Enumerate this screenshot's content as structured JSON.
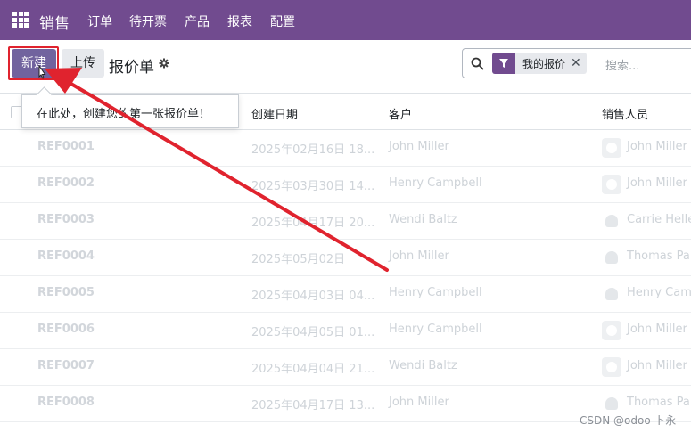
{
  "navbar": {
    "brand": "销售",
    "menu": [
      "订单",
      "待开票",
      "产品",
      "报表",
      "配置"
    ]
  },
  "control": {
    "new_label": "新建",
    "upload_label": "上传",
    "title": "报价单",
    "search": {
      "facet_label": "我的报价",
      "placeholder": "搜索..."
    }
  },
  "tooltip": "在此处，创建您的第一张报价单！",
  "table": {
    "columns": [
      "创建日期",
      "客户",
      "销售人员"
    ],
    "rows": [
      {
        "ref": "REF0001",
        "date": "2025年02月16日 18...",
        "customer": "John Miller",
        "salesperson": "John Miller"
      },
      {
        "ref": "REF0002",
        "date": "2025年03月30日 14...",
        "customer": "Henry Campbell",
        "salesperson": "John Miller"
      },
      {
        "ref": "REF0003",
        "date": "2025年04月17日 20...",
        "customer": "Wendi Baltz",
        "salesperson": "Carrie Helle"
      },
      {
        "ref": "REF0004",
        "date": "2025年05月02日",
        "customer": "John Miller",
        "salesperson": "Thomas Pa"
      },
      {
        "ref": "REF0005",
        "date": "2025年04月03日 04...",
        "customer": "Henry Campbell",
        "salesperson": "Henry Camp"
      },
      {
        "ref": "REF0006",
        "date": "2025年04月05日 01...",
        "customer": "Henry Campbell",
        "salesperson": "John Miller"
      },
      {
        "ref": "REF0007",
        "date": "2025年04月04日 21...",
        "customer": "Wendi Baltz",
        "salesperson": "John Miller"
      },
      {
        "ref": "REF0008",
        "date": "2025年04月17日 13...",
        "customer": "John Miller",
        "salesperson": "Thomas Pa"
      }
    ]
  },
  "watermark": "CSDN @odoo-卜永",
  "colors": {
    "navbar": "#714b8f",
    "primary_button": "#71639e",
    "annotation": "#e0232e"
  }
}
